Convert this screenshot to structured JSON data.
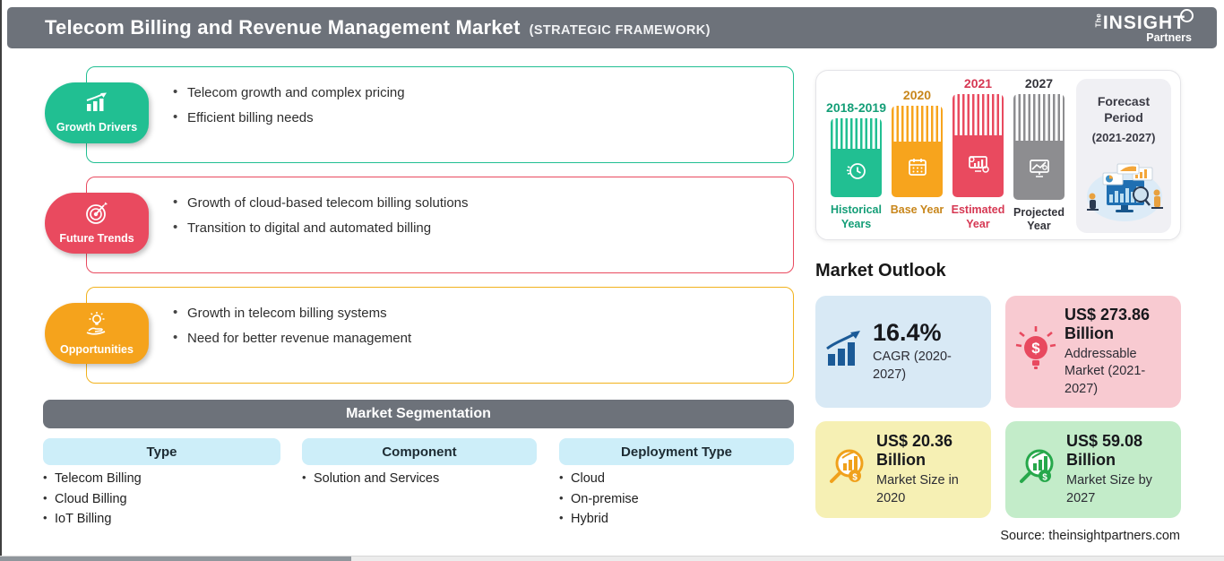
{
  "header": {
    "title": "Telecom Billing and Revenue Management Market",
    "subtitle": "(STRATEGIC FRAMEWORK)",
    "logo": {
      "the": "The",
      "insight": "INSIGHT",
      "partners": "Partners"
    }
  },
  "colors": {
    "header_gray": "#6d727a",
    "growth_green": "#21bf92",
    "trends_red": "#e94a5f",
    "opportunities_orange": "#f5a31c",
    "segment_header_blue": "#cdeef9",
    "projected_gray": "#8d8d90",
    "card_blue_bg": "#d8e9f5",
    "card_pink_bg": "#f8cad1",
    "card_yellow_bg": "#f6f0b4",
    "card_green_bg": "#c3ecc9",
    "cagr_icon_blue": "#1b5a97"
  },
  "sections": [
    {
      "label": "Growth Drivers",
      "bullets": [
        "Telecom growth and complex pricing",
        "Efficient billing needs"
      ]
    },
    {
      "label": "Future Trends",
      "bullets": [
        "Growth of cloud-based telecom billing solutions",
        "Transition to digital and automated billing"
      ]
    },
    {
      "label": "Opportunities",
      "bullets": [
        "Growth in telecom billing systems",
        "Need for better revenue management"
      ]
    }
  ],
  "segmentation": {
    "title": "Market Segmentation",
    "columns": [
      {
        "header": "Type",
        "items": [
          "Telecom Billing",
          "Cloud Billing",
          "IoT Billing"
        ]
      },
      {
        "header": "Component",
        "items": [
          "Solution and Services"
        ]
      },
      {
        "header": "Deployment Type",
        "items": [
          "Cloud",
          "On-premise",
          "Hybrid"
        ]
      }
    ]
  },
  "timeline": {
    "bars": [
      {
        "year": "2018-2019",
        "label": "Historical Years"
      },
      {
        "year": "2020",
        "label": "Base Year"
      },
      {
        "year": "2021",
        "label": "Estimated Year"
      },
      {
        "year": "2027",
        "label": "Projected Year"
      }
    ],
    "forecast": {
      "line1": "Forecast",
      "line2": "Period",
      "range": "(2021-2027)"
    }
  },
  "market_outlook": {
    "title": "Market Outlook",
    "cards": [
      {
        "value": "16.4%",
        "label": "CAGR (2020-2027)"
      },
      {
        "value": "US$ 273.86 Billion",
        "label": "Addressable Market (2021-2027)"
      },
      {
        "value": "US$ 20.36 Billion",
        "label": "Market Size in 2020"
      },
      {
        "value": "US$ 59.08 Billion",
        "label": "Market Size by 2027"
      }
    ]
  },
  "source": "Source: theinsightpartners.com"
}
